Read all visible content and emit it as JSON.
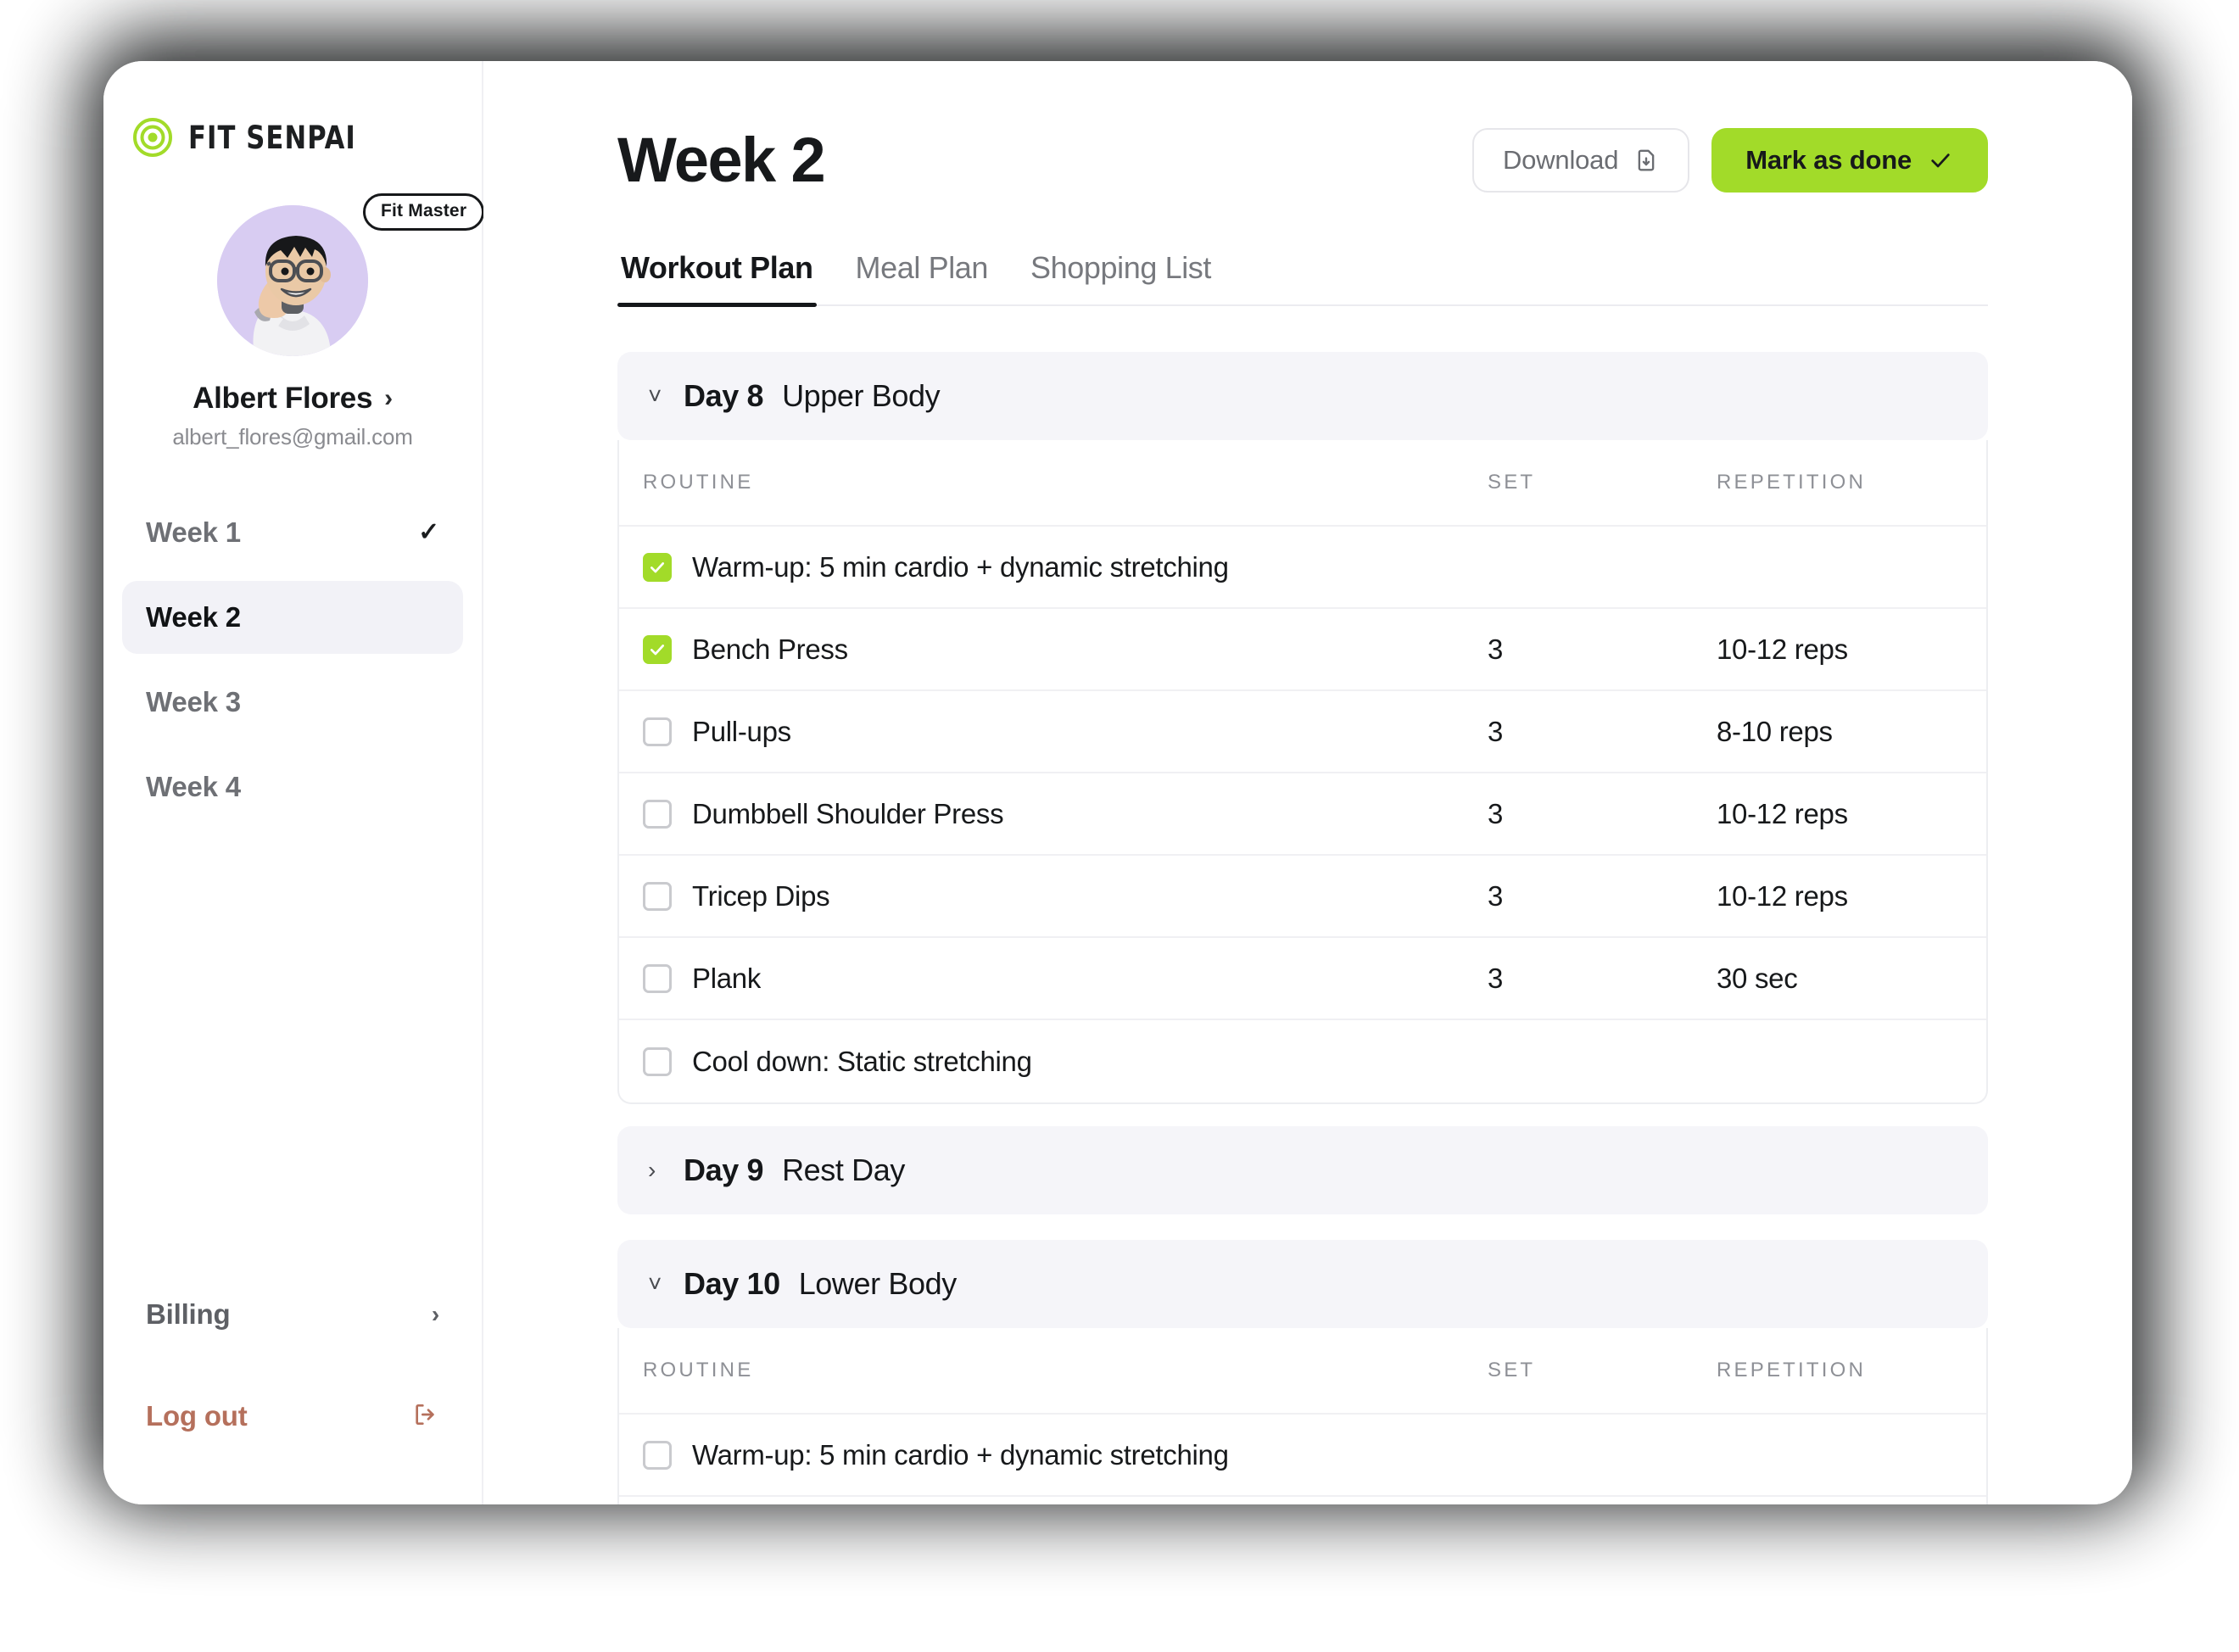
{
  "brand": {
    "name": "FIT SENPAI",
    "mark_icon": "target-icon",
    "accent_color": "#A2DB29"
  },
  "profile": {
    "badge": "Fit Master",
    "name": "Albert Flores",
    "email": "albert_flores@gmail.com",
    "avatar_bg": "#D8CCF2",
    "chevron_icon": "chevron-right-icon"
  },
  "sidebar": {
    "weeks": [
      {
        "label": "Week 1",
        "active": false,
        "completed": true
      },
      {
        "label": "Week 2",
        "active": true,
        "completed": false
      },
      {
        "label": "Week 3",
        "active": false,
        "completed": false
      },
      {
        "label": "Week 4",
        "active": false,
        "completed": false
      }
    ],
    "billing_label": "Billing",
    "billing_icon": "chevron-right-icon",
    "logout_label": "Log out",
    "logout_icon": "logout-icon",
    "logout_color": "#B5705C"
  },
  "header": {
    "title": "Week 2",
    "download_label": "Download",
    "download_icon": "file-download-icon",
    "mark_done_label": "Mark as done",
    "mark_done_icon": "check-icon"
  },
  "tabs": [
    {
      "label": "Workout Plan",
      "active": true
    },
    {
      "label": "Meal Plan",
      "active": false
    },
    {
      "label": "Shopping List",
      "active": false
    }
  ],
  "table_headers": {
    "routine": "ROUTINE",
    "set": "SET",
    "repetition": "REPETITION"
  },
  "days": [
    {
      "day": "Day 8",
      "label": "Upper Body",
      "expanded": true,
      "chevron_icon": "chevron-down-icon",
      "rows": [
        {
          "checked": true,
          "routine": "Warm-up: 5 min cardio + dynamic stretching",
          "set": "",
          "repetition": ""
        },
        {
          "checked": true,
          "routine": "Bench Press",
          "set": "3",
          "repetition": "10-12 reps"
        },
        {
          "checked": false,
          "routine": "Pull-ups",
          "set": "3",
          "repetition": "8-10 reps"
        },
        {
          "checked": false,
          "routine": "Dumbbell Shoulder Press",
          "set": "3",
          "repetition": "10-12 reps"
        },
        {
          "checked": false,
          "routine": "Tricep Dips",
          "set": "3",
          "repetition": "10-12 reps"
        },
        {
          "checked": false,
          "routine": "Plank",
          "set": "3",
          "repetition": "30 sec"
        },
        {
          "checked": false,
          "routine": "Cool down: Static stretching",
          "set": "",
          "repetition": ""
        }
      ]
    },
    {
      "day": "Day 9",
      "label": "Rest Day",
      "expanded": false,
      "chevron_icon": "chevron-right-icon",
      "rows": []
    },
    {
      "day": "Day 10",
      "label": "Lower Body",
      "expanded": true,
      "chevron_icon": "chevron-down-icon",
      "rows": [
        {
          "checked": false,
          "routine": "Warm-up: 5 min cardio + dynamic stretching",
          "set": "",
          "repetition": ""
        }
      ]
    }
  ]
}
